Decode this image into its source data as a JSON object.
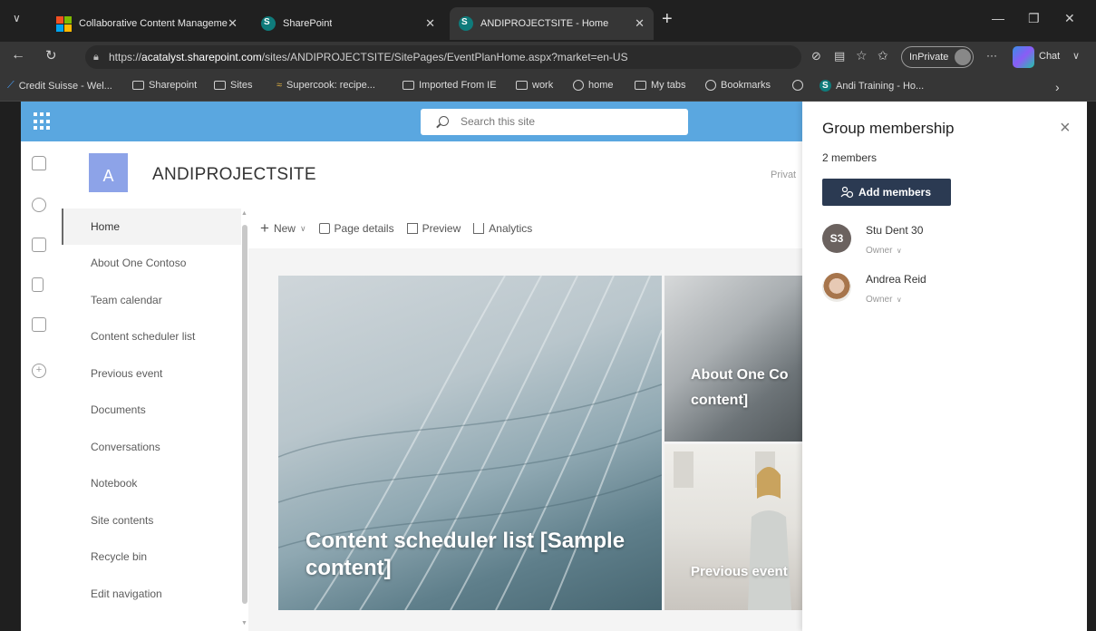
{
  "browser": {
    "tabs": [
      {
        "label": "Collaborative Content Manageme",
        "icon": "microsoft-logo-icon"
      },
      {
        "label": "SharePoint",
        "icon": "sharepoint-icon"
      },
      {
        "label": "ANDIPROJECTSITE - Home",
        "icon": "sharepoint-icon"
      }
    ],
    "new_tab": "+",
    "address": {
      "prefix": "https://",
      "host": "acatalyst.sharepoint.com",
      "path": "/sites/ANDIPROJECTSITE/SitePages/EventPlanHome.aspx?market=en-US"
    },
    "inprivate_label": "InPrivate",
    "chat_label": "Chat",
    "more_label": "···",
    "bookmarks": [
      {
        "label": "Credit Suisse - Wel...",
        "icon": "credit-suisse-icon"
      },
      {
        "label": "Sharepoint",
        "icon": "folder-icon"
      },
      {
        "label": "Sites",
        "icon": "folder-icon"
      },
      {
        "label": "Supercook: recipe...",
        "icon": "supercook-icon"
      },
      {
        "label": "Imported From IE",
        "icon": "folder-icon"
      },
      {
        "label": "work",
        "icon": "folder-icon"
      },
      {
        "label": "home",
        "icon": "globe-icon"
      },
      {
        "label": "My tabs",
        "icon": "folder-icon"
      },
      {
        "label": "Bookmarks",
        "icon": "globe-icon"
      },
      {
        "label": "",
        "icon": "globe-icon"
      },
      {
        "label": "Andi Training - Ho...",
        "icon": "sharepoint-icon"
      }
    ],
    "bookmarks_overflow": "›"
  },
  "sharepoint": {
    "search_placeholder": "Search this site",
    "site_initial": "A",
    "site_title": "ANDIPROJECTSITE",
    "privacy_partial": "Privat",
    "nav": [
      "Home",
      "About One Contoso",
      "Team calendar",
      "Content scheduler list",
      "Previous event",
      "Documents",
      "Conversations",
      "Notebook",
      "Site contents",
      "Recycle bin",
      "Edit navigation"
    ],
    "commands": [
      {
        "label": "New",
        "icon": "plus-icon"
      },
      {
        "label": "Page details",
        "icon": "page-details-icon"
      },
      {
        "label": "Preview",
        "icon": "preview-icon"
      },
      {
        "label": "Analytics",
        "icon": "analytics-icon"
      }
    ],
    "hero": {
      "main": "Content scheduler list [Sample content]",
      "top_right_line1": "About One Co",
      "top_right_line2": "content]",
      "bottom_right": "Previous event"
    }
  },
  "group_panel": {
    "title": "Group membership",
    "count": "2 members",
    "add_button": "Add members",
    "members": [
      {
        "initials": "S3",
        "name": "Stu Dent 30",
        "role": "Owner"
      },
      {
        "initials": "",
        "name": "Andrea Reid",
        "role": "Owner"
      }
    ]
  },
  "colors": {
    "suite_bar": "#5aa7e0",
    "site_icon": "#8da3e8",
    "add_button": "#2b3a52",
    "avatar_s3": "#6b625f"
  }
}
